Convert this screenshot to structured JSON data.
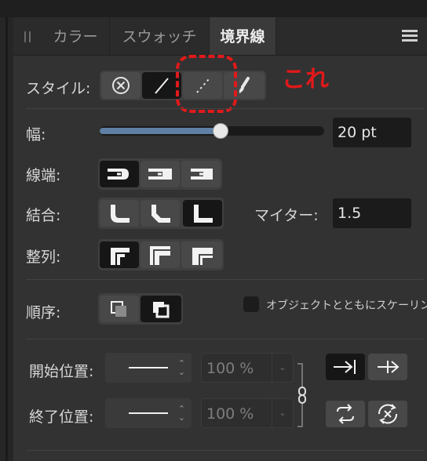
{
  "tabs": {
    "items": [
      {
        "label": "カラー",
        "active": false
      },
      {
        "label": "スウォッチ",
        "active": false
      },
      {
        "label": "境界線",
        "active": true
      }
    ]
  },
  "style_row": {
    "label": "スタイル:",
    "buttons": [
      {
        "name": "none",
        "icon": "circle-x-icon",
        "selected": false
      },
      {
        "name": "solid",
        "icon": "solid-line-icon",
        "selected": true
      },
      {
        "name": "dashed",
        "icon": "dashed-line-icon",
        "selected": false
      },
      {
        "name": "brush",
        "icon": "brush-icon",
        "selected": false
      }
    ]
  },
  "annotation": {
    "text": "これ",
    "color": "#e0191b"
  },
  "width_row": {
    "label": "幅:",
    "value": "20 pt",
    "slider_fraction": 0.54
  },
  "cap_row": {
    "label": "線端:",
    "selected_index": 0
  },
  "join_row": {
    "label": "結合:",
    "selected_index": 2,
    "miter_label": "マイター:",
    "miter_value": "1.5"
  },
  "align_row": {
    "label": "整列:",
    "selected_index": 0
  },
  "order_row": {
    "label": "順序:",
    "selected_index": 1,
    "scale_checkbox_label": "オブジェクトとともにスケーリング",
    "scale_checked": false
  },
  "start_row": {
    "label": "開始位置:",
    "percent": "100 %"
  },
  "end_row": {
    "label": "終了位置:",
    "percent": "100 %"
  },
  "colors": {
    "accent": "#5f7fa4",
    "panel": "#323232",
    "selected": "#161616"
  }
}
